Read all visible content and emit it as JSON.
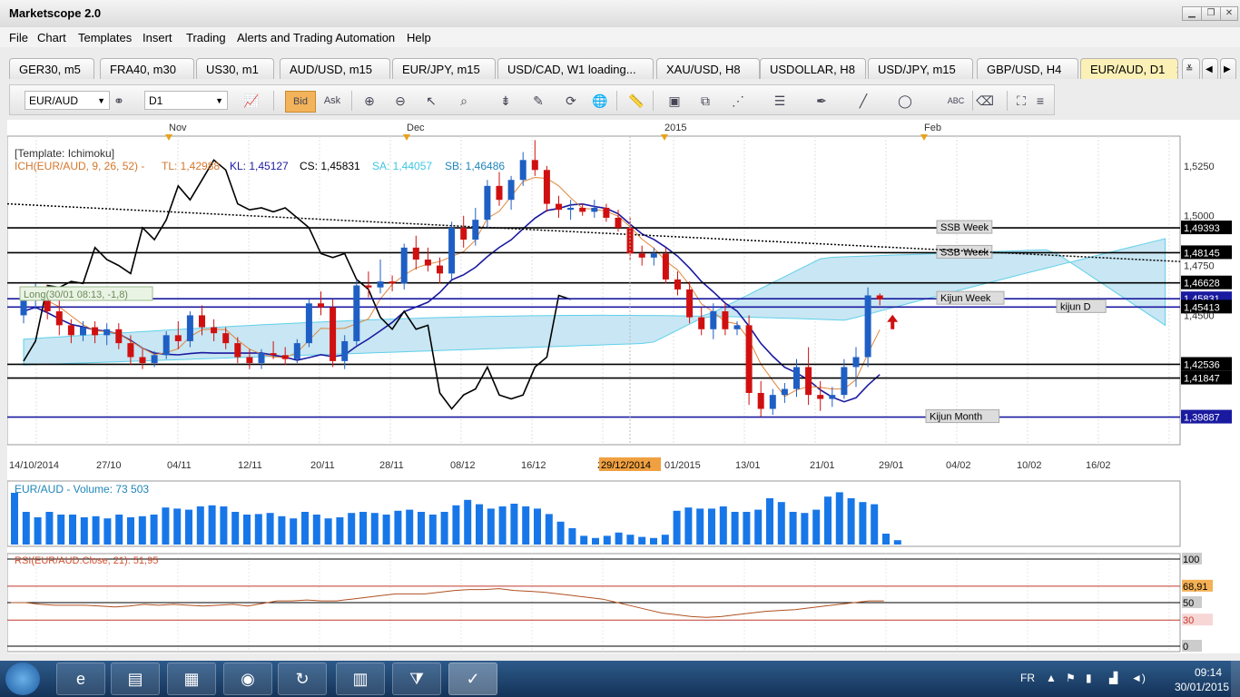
{
  "app": {
    "title": "Marketscope 2.0"
  },
  "menu": [
    "File",
    "Chart",
    "Templates",
    "Insert",
    "Trading",
    "Alerts and Trading Automation",
    "Help"
  ],
  "tabs": [
    "GER30, m5",
    "FRA40, m30",
    "US30, m1",
    "AUD/USD, m15",
    "EUR/JPY, m15",
    "USD/CAD, W1 loading...",
    "XAU/USD, H8",
    "USDOLLAR, H8",
    "USD/JPY, m15",
    "GBP/USD, H4",
    "EUR/AUD, D1"
  ],
  "active_tab_close": "✕",
  "toolbar": {
    "symbol": "EUR/AUD",
    "timeframe": "D1",
    "bid_label": "Bid",
    "ask_label": "Ask"
  },
  "chart": {
    "month_labels": [
      "Nov",
      "Dec",
      "2015",
      "Feb"
    ],
    "template_label": "[Template: Ichimoku]",
    "ichimoku_label": "ICH(EUR/AUD, 9, 26, 52) -",
    "tl_label": "TL: 1,42988",
    "kl_label": "KL: 1,45127",
    "cs_label": "CS: 1,45831",
    "sa_label": "SA: 1,44057",
    "sb_label": "SB: 1,46486",
    "position_label": "Long(30/01 08:13, -1,8)",
    "price_ticks": [
      "1,5250",
      "1,5000",
      "1,4750",
      "1,4500"
    ],
    "level_labels": [
      {
        "text": "SSB Week",
        "price": "1,49393"
      },
      {
        "text": "SSB Week",
        "price": "1,48145"
      },
      {
        "text": "",
        "price": "1,46628"
      },
      {
        "text": "Kijun Week",
        "price": "1,45831"
      },
      {
        "text": "kijun D",
        "price": "1,45413"
      },
      {
        "text": "",
        "price": "1,42536"
      },
      {
        "text": "",
        "price": "1,41847"
      },
      {
        "text": "Kijun Month",
        "price": "1,39887"
      }
    ],
    "date_ticks": [
      "14/10/2014",
      "27/10",
      "04/11",
      "12/11",
      "20/11",
      "28/11",
      "08/12",
      "16/12",
      "2",
      "01/2015",
      "13/01",
      "21/01",
      "29/01",
      "04/02",
      "10/02",
      "16/02"
    ],
    "cursor_date": "29/12/2014",
    "volume_label": "EUR/AUD - Volume: 73 503",
    "rsi_label": "RSI(EUR/AUD.Close, 21): 51,95",
    "rsi_ticks": [
      "100",
      "68,91",
      "50",
      "30",
      "0"
    ]
  },
  "chart_data": {
    "type": "candlestick",
    "symbol": "EUR/AUD",
    "timeframe": "D1",
    "ylim": [
      1.385,
      1.54
    ],
    "candles": [
      [
        1.45,
        1.462,
        1.446,
        1.458
      ],
      [
        1.458,
        1.466,
        1.453,
        1.462
      ],
      [
        1.462,
        1.465,
        1.448,
        1.452
      ],
      [
        1.452,
        1.458,
        1.44,
        1.445
      ],
      [
        1.445,
        1.448,
        1.436,
        1.44
      ],
      [
        1.44,
        1.447,
        1.437,
        1.444
      ],
      [
        1.444,
        1.447,
        1.436,
        1.44
      ],
      [
        1.44,
        1.446,
        1.435,
        1.443
      ],
      [
        1.443,
        1.446,
        1.433,
        1.436
      ],
      [
        1.436,
        1.44,
        1.425,
        1.429
      ],
      [
        1.429,
        1.433,
        1.423,
        1.426
      ],
      [
        1.426,
        1.432,
        1.424,
        1.43
      ],
      [
        1.43,
        1.442,
        1.428,
        1.44
      ],
      [
        1.44,
        1.447,
        1.433,
        1.437
      ],
      [
        1.437,
        1.452,
        1.434,
        1.45
      ],
      [
        1.45,
        1.455,
        1.44,
        1.444
      ],
      [
        1.444,
        1.448,
        1.437,
        1.441
      ],
      [
        1.441,
        1.444,
        1.433,
        1.436
      ],
      [
        1.436,
        1.439,
        1.426,
        1.429
      ],
      [
        1.429,
        1.433,
        1.423,
        1.426
      ],
      [
        1.426,
        1.433,
        1.423,
        1.431
      ],
      [
        1.431,
        1.437,
        1.428,
        1.43
      ],
      [
        1.43,
        1.434,
        1.425,
        1.428
      ],
      [
        1.428,
        1.438,
        1.426,
        1.436
      ],
      [
        1.436,
        1.458,
        1.434,
        1.456
      ],
      [
        1.456,
        1.462,
        1.45,
        1.454
      ],
      [
        1.454,
        1.458,
        1.424,
        1.427
      ],
      [
        1.427,
        1.44,
        1.423,
        1.437
      ],
      [
        1.437,
        1.468,
        1.435,
        1.465
      ],
      [
        1.465,
        1.472,
        1.459,
        1.464
      ],
      [
        1.464,
        1.478,
        1.461,
        1.467
      ],
      [
        1.467,
        1.47,
        1.462,
        1.466
      ],
      [
        1.466,
        1.486,
        1.463,
        1.484
      ],
      [
        1.484,
        1.49,
        1.473,
        1.478
      ],
      [
        1.478,
        1.484,
        1.472,
        1.475
      ],
      [
        1.475,
        1.479,
        1.466,
        1.471
      ],
      [
        1.471,
        1.497,
        1.468,
        1.494
      ],
      [
        1.494,
        1.5,
        1.484,
        1.488
      ],
      [
        1.488,
        1.504,
        1.485,
        1.498
      ],
      [
        1.498,
        1.518,
        1.494,
        1.515
      ],
      [
        1.515,
        1.522,
        1.505,
        1.508
      ],
      [
        1.508,
        1.52,
        1.503,
        1.518
      ],
      [
        1.518,
        1.532,
        1.515,
        1.528
      ],
      [
        1.528,
        1.538,
        1.52,
        1.523
      ],
      [
        1.523,
        1.525,
        1.502,
        1.506
      ],
      [
        1.506,
        1.51,
        1.499,
        1.503
      ],
      [
        1.503,
        1.508,
        1.498,
        1.504
      ],
      [
        1.504,
        1.506,
        1.5,
        1.502
      ],
      [
        1.502,
        1.508,
        1.499,
        1.504
      ],
      [
        1.504,
        1.506,
        1.497,
        1.499
      ],
      [
        1.499,
        1.503,
        1.492,
        1.494
      ],
      [
        1.494,
        1.499,
        1.478,
        1.481
      ],
      [
        1.481,
        1.485,
        1.475,
        1.479
      ],
      [
        1.479,
        1.484,
        1.475,
        1.481
      ],
      [
        1.481,
        1.484,
        1.466,
        1.468
      ],
      [
        1.468,
        1.472,
        1.46,
        1.463
      ],
      [
        1.463,
        1.467,
        1.446,
        1.449
      ],
      [
        1.449,
        1.454,
        1.44,
        1.443
      ],
      [
        1.443,
        1.456,
        1.438,
        1.452
      ],
      [
        1.452,
        1.456,
        1.44,
        1.443
      ],
      [
        1.443,
        1.447,
        1.44,
        1.445
      ],
      [
        1.445,
        1.45,
        1.405,
        1.411
      ],
      [
        1.411,
        1.417,
        1.399,
        1.403
      ],
      [
        1.403,
        1.413,
        1.4,
        1.41
      ],
      [
        1.41,
        1.416,
        1.406,
        1.413
      ],
      [
        1.413,
        1.428,
        1.409,
        1.424
      ],
      [
        1.424,
        1.434,
        1.405,
        1.41
      ],
      [
        1.41,
        1.417,
        1.402,
        1.408
      ],
      [
        1.408,
        1.414,
        1.404,
        1.41
      ],
      [
        1.41,
        1.428,
        1.408,
        1.424
      ],
      [
        1.424,
        1.434,
        1.414,
        1.429
      ],
      [
        1.429,
        1.464,
        1.424,
        1.46
      ],
      [
        1.46,
        1.461,
        1.455,
        1.458
      ]
    ],
    "volume": [
      95,
      60,
      50,
      60,
      55,
      55,
      50,
      52,
      48,
      55,
      50,
      52,
      55,
      68,
      66,
      64,
      70,
      72,
      70,
      60,
      55,
      56,
      58,
      52,
      48,
      60,
      55,
      48,
      50,
      58,
      60,
      58,
      55,
      62,
      64,
      60,
      55,
      60,
      72,
      82,
      74,
      66,
      70,
      75,
      70,
      66,
      56,
      42,
      30,
      16,
      12,
      16,
      22,
      18,
      14,
      12,
      18,
      62,
      68,
      66,
      66,
      70,
      60,
      60,
      64,
      85,
      78,
      60,
      58,
      64,
      88,
      96,
      85,
      78,
      74,
      20,
      8
    ],
    "rsi": [
      50,
      50,
      48,
      47,
      47,
      47,
      46,
      45,
      46,
      48,
      47,
      48,
      47,
      46,
      47,
      48,
      46,
      49,
      52,
      52,
      53,
      52,
      52,
      54,
      56,
      58,
      60,
      60,
      60,
      62,
      64,
      65,
      65,
      66,
      64,
      63,
      62,
      60,
      58,
      56,
      54,
      50,
      46,
      42,
      38,
      36,
      34,
      33,
      34,
      36,
      38,
      40,
      41,
      42,
      44,
      46,
      48,
      50,
      52,
      52
    ]
  },
  "taskbar": {
    "language": "FR",
    "time": "09:14",
    "date": "30/01/2015"
  }
}
